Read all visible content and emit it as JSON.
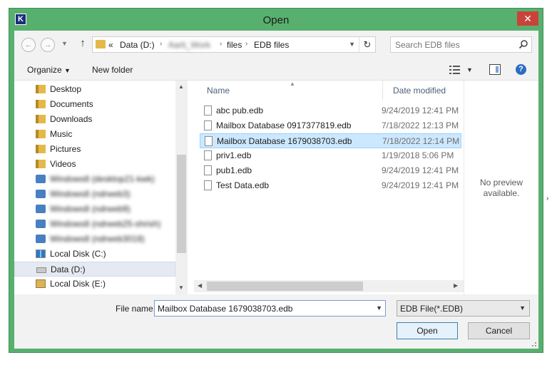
{
  "window": {
    "title": "Open",
    "app_icon_letter": "K",
    "close_glyph": "✕"
  },
  "address": {
    "prefix": "«",
    "segments": [
      "Data (D:)",
      "Aarti_Work",
      "files",
      "EDB files"
    ],
    "separator": "›"
  },
  "search": {
    "placeholder": "Search EDB files"
  },
  "toolbar": {
    "organize_label": "Organize",
    "organize_arrow": "▼",
    "new_folder_label": "New folder",
    "help_glyph": "?"
  },
  "nav_pane": {
    "items": [
      {
        "label": "Desktop",
        "icon": "folder-icon"
      },
      {
        "label": "Documents",
        "icon": "folder-icon"
      },
      {
        "label": "Downloads",
        "icon": "folder-icon"
      },
      {
        "label": "Music",
        "icon": "folder-icon"
      },
      {
        "label": "Pictures",
        "icon": "folder-icon"
      },
      {
        "label": "Videos",
        "icon": "folder-icon"
      },
      {
        "label": "Windows8 (desktop21-kwk)",
        "icon": "network-icon"
      },
      {
        "label": "Windows8 (ndrweb3)",
        "icon": "network-icon"
      },
      {
        "label": "Windows8 (ndrweb9)",
        "icon": "network-icon"
      },
      {
        "label": "Windows8 (ndrweb25-shrish)",
        "icon": "network-icon"
      },
      {
        "label": "Windows8 (ndrweb3018)",
        "icon": "network-icon"
      },
      {
        "label": "Local Disk (C:)",
        "icon": "windows-drive-icon"
      },
      {
        "label": "Data (D:)",
        "icon": "drive-icon"
      },
      {
        "label": "Local Disk (E:)",
        "icon": "locked-drive-icon"
      }
    ],
    "selected_index": 12
  },
  "file_list": {
    "columns": {
      "name": "Name",
      "date": "Date modified"
    },
    "rows": [
      {
        "name": "abc pub.edb",
        "date": "9/24/2019 12:41 PM"
      },
      {
        "name": "Mailbox Database 0917377819.edb",
        "date": "7/18/2022 12:13 PM"
      },
      {
        "name": "Mailbox Database 1679038703.edb",
        "date": "7/18/2022 12:14 PM"
      },
      {
        "name": "priv1.edb",
        "date": "1/19/2018 5:06 PM"
      },
      {
        "name": "pub1.edb",
        "date": "9/24/2019 12:41 PM"
      },
      {
        "name": "Test Data.edb",
        "date": "9/24/2019 12:41 PM"
      }
    ],
    "selected_index": 2
  },
  "preview": {
    "line1": "No preview",
    "line2": "available."
  },
  "bottom": {
    "file_name_label": "File name:",
    "file_name_value": "Mailbox Database 1679038703.edb",
    "filter_value": "EDB File(*.EDB)",
    "open_label": "Open",
    "cancel_label": "Cancel"
  }
}
